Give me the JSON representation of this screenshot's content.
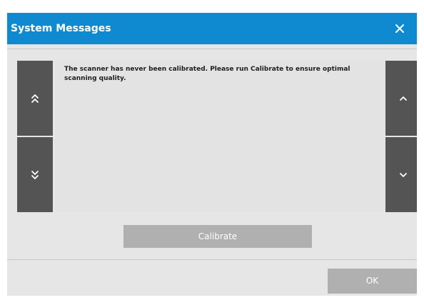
{
  "dialog": {
    "title": "System Messages",
    "close_icon": "close-icon",
    "colors": {
      "titlebar": "#0f8ad0",
      "side_buttons": "#545454",
      "action_buttons": "#b0b0b0"
    }
  },
  "navigation": {
    "page_up_icon": "double-chevron-up-icon",
    "page_down_icon": "double-chevron-down-icon",
    "line_up_icon": "chevron-up-icon",
    "line_down_icon": "chevron-down-icon"
  },
  "message": {
    "text": "The scanner has never been calibrated. Please run Calibrate to ensure optimal scanning quality."
  },
  "actions": {
    "calibrate_label": "Calibrate",
    "ok_label": "OK"
  }
}
